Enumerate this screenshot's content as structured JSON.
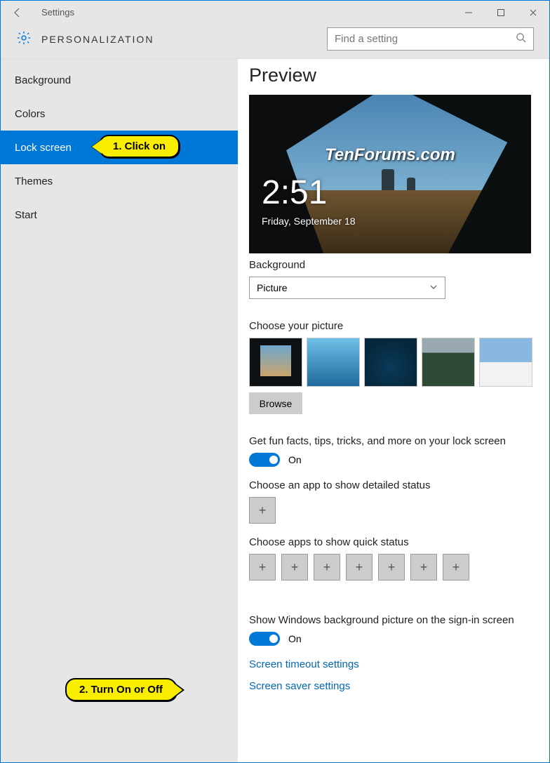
{
  "window": {
    "title": "Settings"
  },
  "header": {
    "category": "PERSONALIZATION",
    "search_placeholder": "Find a setting"
  },
  "sidebar": {
    "items": [
      {
        "label": "Background"
      },
      {
        "label": "Colors"
      },
      {
        "label": "Lock screen"
      },
      {
        "label": "Themes"
      },
      {
        "label": "Start"
      }
    ],
    "selected_index": 2
  },
  "content": {
    "preview_heading": "Preview",
    "preview": {
      "watermark": "TenForums.com",
      "time": "2:51",
      "date": "Friday, September 18"
    },
    "background": {
      "label": "Background",
      "value": "Picture"
    },
    "choose_picture": {
      "label": "Choose your picture",
      "browse": "Browse"
    },
    "fun_facts": {
      "label": "Get fun facts, tips, tricks, and more on your lock screen",
      "state": "On"
    },
    "detailed_status": {
      "label": "Choose an app to show detailed status"
    },
    "quick_status": {
      "label": "Choose apps to show quick status"
    },
    "signin_bg": {
      "label": "Show Windows background picture on the sign-in screen",
      "state": "On"
    },
    "links": {
      "timeout": "Screen timeout settings",
      "saver": "Screen saver settings"
    }
  },
  "annotations": {
    "step1": "1. Click on",
    "step2": "2. Turn On or Off"
  }
}
